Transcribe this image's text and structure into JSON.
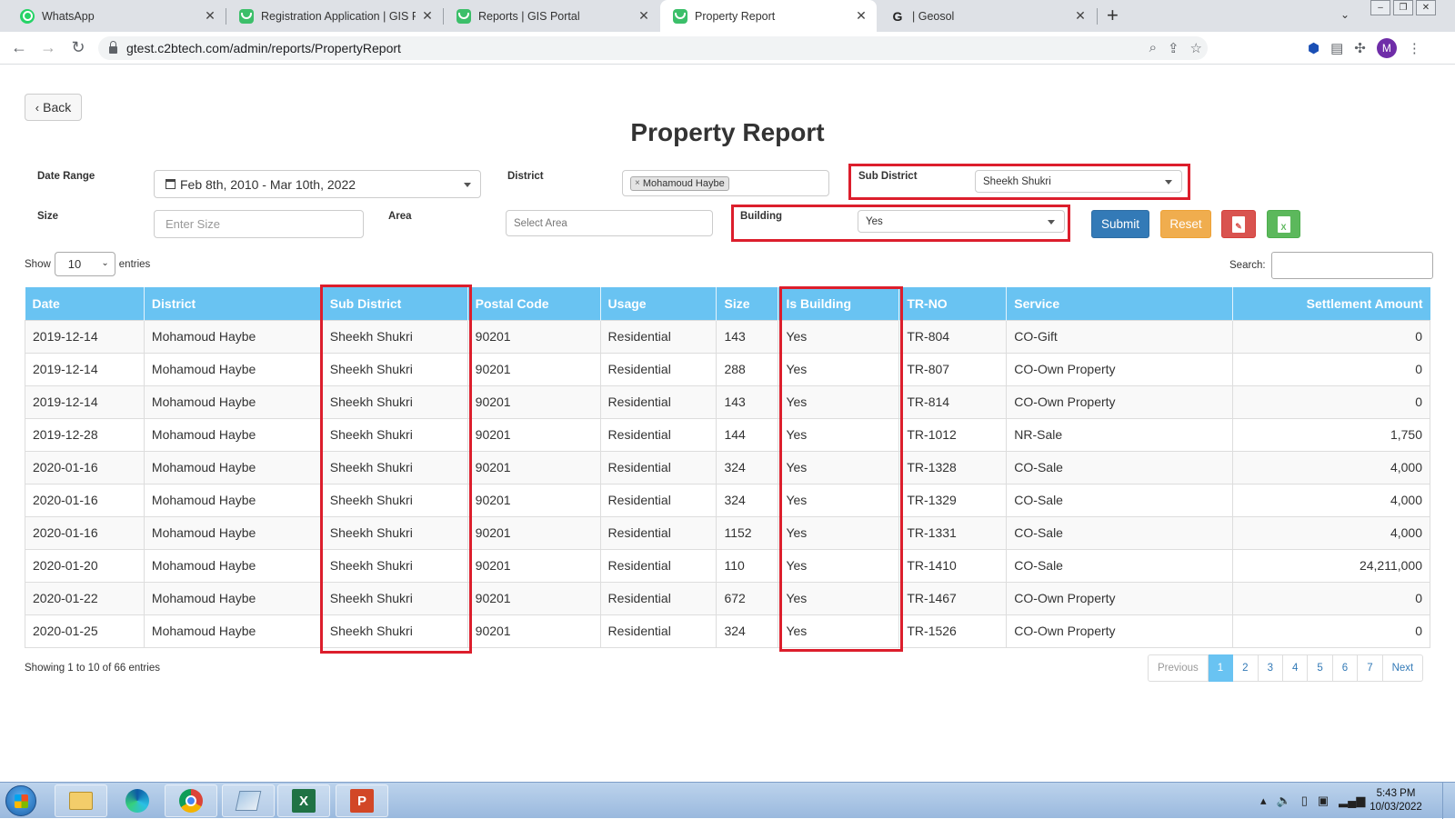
{
  "browser": {
    "tabs": [
      {
        "title": "WhatsApp",
        "icon": "whatsapp-icon"
      },
      {
        "title": "Registration Application | GIS Por",
        "icon": "gis-portal-icon"
      },
      {
        "title": "Reports | GIS Portal",
        "icon": "gis-portal-icon"
      },
      {
        "title": "Property Report",
        "icon": "gis-portal-icon",
        "active": true
      },
      {
        "title": "| Geosol",
        "icon": "google-icon"
      }
    ],
    "url": "gtest.c2btech.com/admin/reports/PropertyReport",
    "avatar_letter": "M"
  },
  "page": {
    "back_label": "Back",
    "title": "Property Report"
  },
  "filters": {
    "date_range_label": "Date Range",
    "date_range_value": "Feb 8th, 2010 - Mar 10th, 2022",
    "district_label": "District",
    "district_chip": "Mohamoud Haybe",
    "sub_district_label": "Sub District",
    "sub_district_value": "Sheekh Shukri",
    "size_label": "Size",
    "size_placeholder": "Enter Size",
    "area_label": "Area",
    "area_placeholder": "Select Area",
    "building_label": "Building",
    "building_value": "Yes",
    "submit_label": "Submit",
    "reset_label": "Reset"
  },
  "table_controls": {
    "show_label": "Show",
    "entries_label": "entries",
    "page_length": "10",
    "search_label": "Search:"
  },
  "table": {
    "columns": [
      "Date",
      "District",
      "Sub District",
      "Postal Code",
      "Usage",
      "Size",
      "Is Building",
      "TR-NO",
      "Service",
      "Settlement Amount"
    ],
    "rows": [
      [
        "2019-12-14",
        "Mohamoud Haybe",
        "Sheekh Shukri",
        "90201",
        "Residential",
        "143",
        "Yes",
        "TR-804",
        "CO-Gift",
        "0"
      ],
      [
        "2019-12-14",
        "Mohamoud Haybe",
        "Sheekh Shukri",
        "90201",
        "Residential",
        "288",
        "Yes",
        "TR-807",
        "CO-Own Property",
        "0"
      ],
      [
        "2019-12-14",
        "Mohamoud Haybe",
        "Sheekh Shukri",
        "90201",
        "Residential",
        "143",
        "Yes",
        "TR-814",
        "CO-Own Property",
        "0"
      ],
      [
        "2019-12-28",
        "Mohamoud Haybe",
        "Sheekh Shukri",
        "90201",
        "Residential",
        "144",
        "Yes",
        "TR-1012",
        "NR-Sale",
        "1,750"
      ],
      [
        "2020-01-16",
        "Mohamoud Haybe",
        "Sheekh Shukri",
        "90201",
        "Residential",
        "324",
        "Yes",
        "TR-1328",
        "CO-Sale",
        "4,000"
      ],
      [
        "2020-01-16",
        "Mohamoud Haybe",
        "Sheekh Shukri",
        "90201",
        "Residential",
        "324",
        "Yes",
        "TR-1329",
        "CO-Sale",
        "4,000"
      ],
      [
        "2020-01-16",
        "Mohamoud Haybe",
        "Sheekh Shukri",
        "90201",
        "Residential",
        "1152",
        "Yes",
        "TR-1331",
        "CO-Sale",
        "4,000"
      ],
      [
        "2020-01-20",
        "Mohamoud Haybe",
        "Sheekh Shukri",
        "90201",
        "Residential",
        "110",
        "Yes",
        "TR-1410",
        "CO-Sale",
        "24,211,000"
      ],
      [
        "2020-01-22",
        "Mohamoud Haybe",
        "Sheekh Shukri",
        "90201",
        "Residential",
        "672",
        "Yes",
        "TR-1467",
        "CO-Own Property",
        "0"
      ],
      [
        "2020-01-25",
        "Mohamoud Haybe",
        "Sheekh Shukri",
        "90201",
        "Residential",
        "324",
        "Yes",
        "TR-1526",
        "CO-Own Property",
        "0"
      ]
    ],
    "info": "Showing 1 to 10 of 66 entries"
  },
  "pagination": {
    "previous": "Previous",
    "pages": [
      "1",
      "2",
      "3",
      "4",
      "5",
      "6",
      "7"
    ],
    "current": "1",
    "next": "Next"
  },
  "taskbar": {
    "time": "5:43 PM",
    "date": "10/03/2022"
  },
  "colors": {
    "header_blue": "#69c3f2",
    "highlight_red": "#dc1e2c",
    "submit_blue": "#337ab7",
    "reset_orange": "#f0ad4e",
    "pdf_red": "#d9534f",
    "excel_green": "#5cb85c"
  }
}
